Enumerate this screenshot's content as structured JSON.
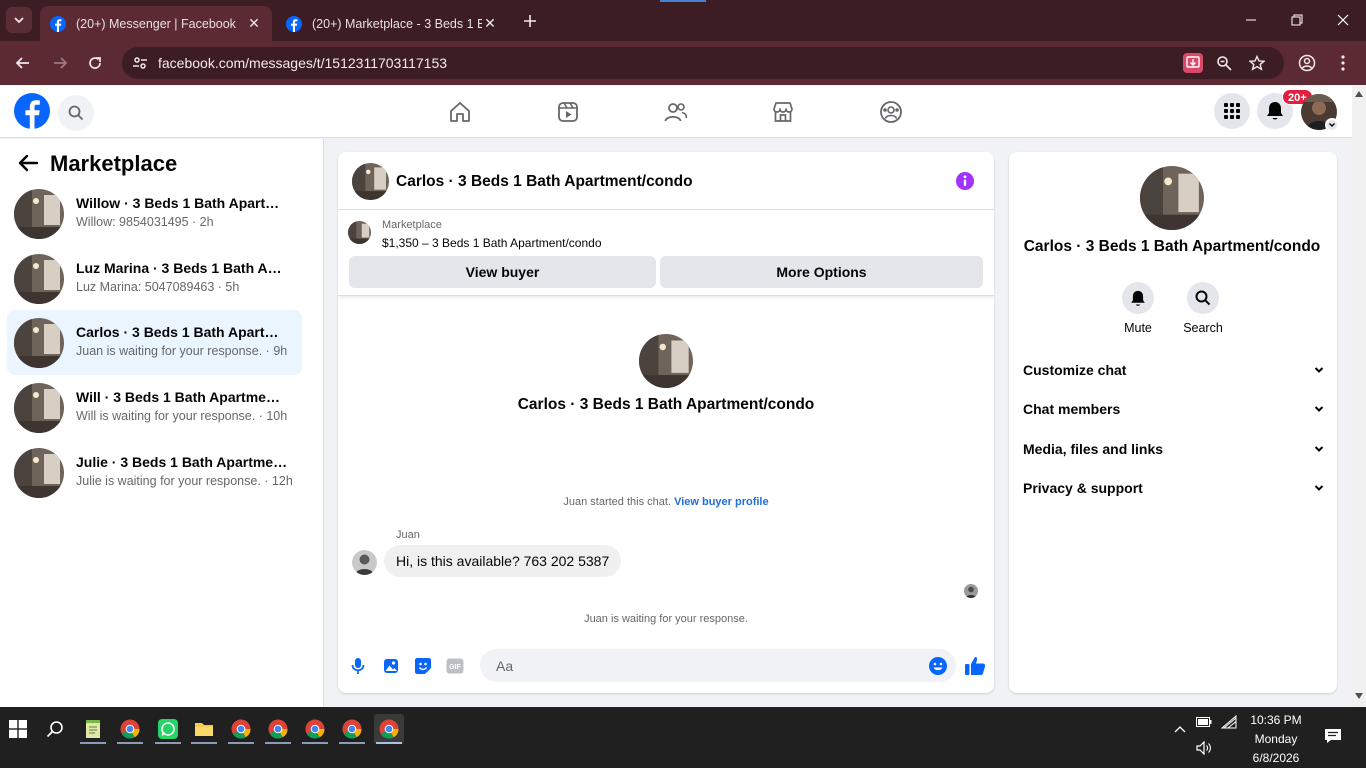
{
  "browser": {
    "tabs": [
      {
        "title": "(20+) Messenger | Facebook",
        "active": true
      },
      {
        "title": "(20+) Marketplace - 3 Beds 1 Ba",
        "active": false
      }
    ],
    "url": "facebook.com/messages/t/1512311703117153"
  },
  "fb_header": {
    "notification_badge": "20+",
    "nav": [
      "home-icon",
      "video-icon",
      "friends-icon",
      "marketplace-icon",
      "groups-icon"
    ],
    "brand_color": "#0866ff"
  },
  "sidebar": {
    "title": "Marketplace",
    "conversations": [
      {
        "name": "Willow · 3 Beds 1 Bath Apartment/condo",
        "preview": "Willow: 9854031495 · 2h",
        "active": false
      },
      {
        "name": "Luz Marina · 3 Beds 1 Bath Apartment/condo",
        "preview": "Luz Marina: 5047089463 · 5h",
        "active": false
      },
      {
        "name": "Carlos · 3 Beds 1 Bath Apartment/condo",
        "preview": "Juan is waiting for your response. · 9h",
        "active": true
      },
      {
        "name": "Will · 3 Beds 1 Bath Apartment/condo",
        "preview": "Will is waiting for your response. · 10h",
        "active": false
      },
      {
        "name": "Julie · 3 Beds 1 Bath Apartment/condo",
        "preview": "Julie is waiting for your response. · 12h",
        "active": false
      }
    ]
  },
  "chat": {
    "title": "Carlos · 3 Beds 1 Bath Apartment/condo",
    "listing": {
      "source": "Marketplace",
      "price_title": "$1,350 – 3 Beds 1 Bath Apartment/condo",
      "view_buyer": "View buyer",
      "more_options": "More Options"
    },
    "intro_title": "Carlos · 3 Beds 1 Bath Apartment/condo",
    "started_text": "Juan started this chat.",
    "view_profile": "View buyer profile",
    "sender": "Juan",
    "message": "Hi, is this available? 763 202 5387",
    "waiting": "Juan is waiting for your response.",
    "input_placeholder": "Aa",
    "accent_color": "#0866ff",
    "info_color": "#a033ff"
  },
  "right_panel": {
    "title": "Carlos · 3 Beds 1 Bath Apartment/condo",
    "mute": "Mute",
    "search": "Search",
    "sections": [
      "Customize chat",
      "Chat members",
      "Media, files and links",
      "Privacy & support"
    ]
  },
  "taskbar": {
    "time": "10:36 PM",
    "day": "Monday",
    "date": "6/8/2026"
  }
}
